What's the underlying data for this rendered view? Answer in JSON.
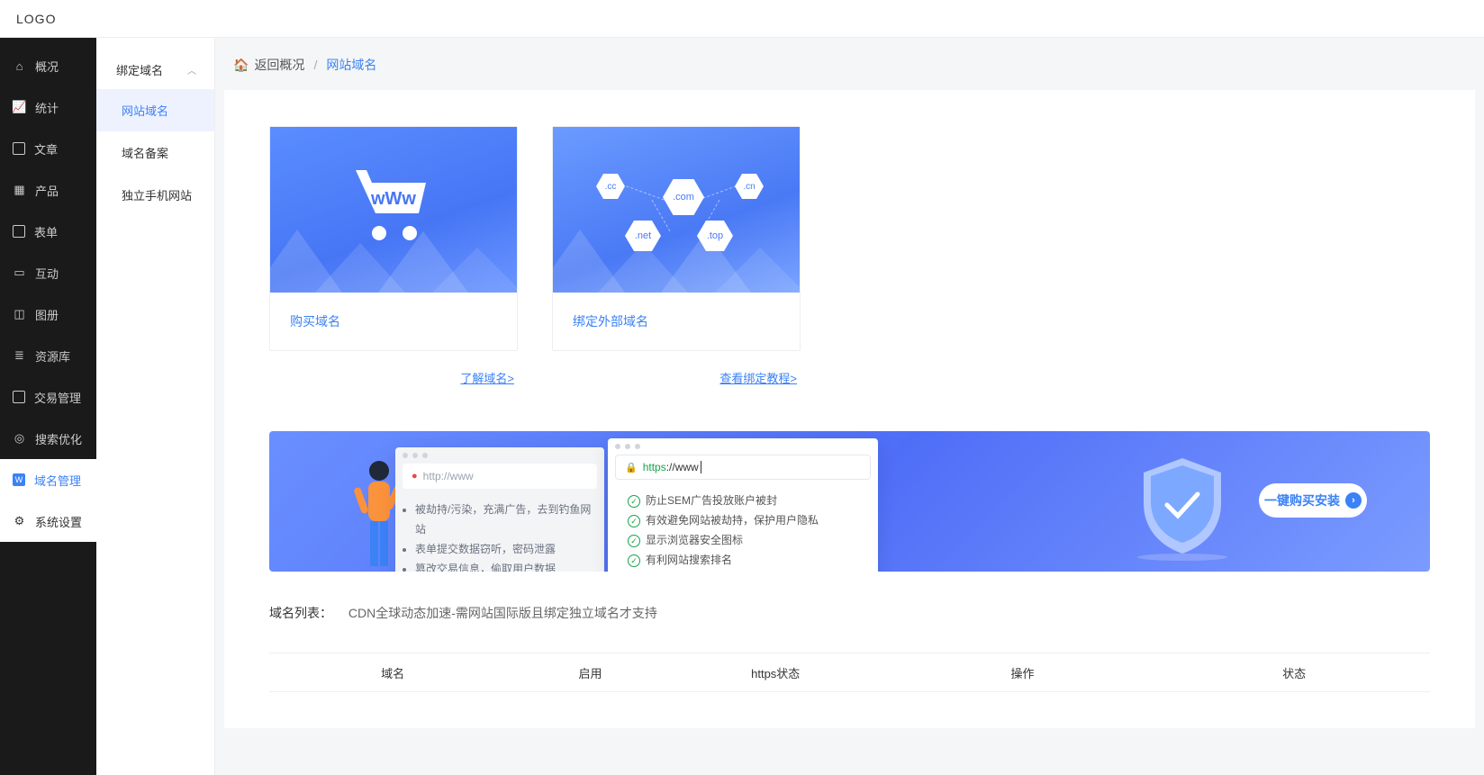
{
  "header": {
    "logo": "LOGO"
  },
  "sidebar": [
    {
      "icon": "home",
      "label": "概况"
    },
    {
      "icon": "chart",
      "label": "统计"
    },
    {
      "icon": "doc",
      "label": "文章"
    },
    {
      "icon": "grid",
      "label": "产品"
    },
    {
      "icon": "form",
      "label": "表单"
    },
    {
      "icon": "chat",
      "label": "互动"
    },
    {
      "icon": "gallery",
      "label": "图册"
    },
    {
      "icon": "db",
      "label": "资源库"
    },
    {
      "icon": "trade",
      "label": "交易管理"
    },
    {
      "icon": "search",
      "label": "搜索优化"
    },
    {
      "icon": "w",
      "label": "域名管理",
      "activeBlue": true
    },
    {
      "icon": "gear",
      "label": "系统设置",
      "whiteBg": true
    }
  ],
  "subnav": {
    "title": "绑定域名",
    "items": [
      {
        "label": "网站域名",
        "active": true
      },
      {
        "label": "域名备案"
      },
      {
        "label": "独立手机网站"
      }
    ]
  },
  "breadcrumb": {
    "back": "返回概况",
    "sep": "/",
    "current": "网站域名"
  },
  "cards": [
    {
      "label": "购买域名",
      "link": "了解域名>"
    },
    {
      "label": "绑定外部域名",
      "link": "查看绑定教程>"
    }
  ],
  "tlds": {
    "cc": ".cc",
    "com": ".com",
    "cn": ".cn",
    "net": ".net",
    "top": ".top"
  },
  "banner": {
    "http": "http://www",
    "https_prefix": "https",
    "https_rest": "://www",
    "left": [
      "被劫持/污染，充满广告，去到钓鱼网站",
      "表单提交数据窃听，密码泄露",
      "篡改交易信息，偷取用户数据"
    ],
    "right": [
      "防止SEM广告投放账户被封",
      "有效避免网站被劫持，保护用户隐私",
      "显示浏览器安全图标",
      "有利网站搜索排名"
    ],
    "button": "一键购买安装"
  },
  "list": {
    "title": "域名列表：",
    "sub": "CDN全球动态加速-需网站国际版且绑定独立域名才支持"
  },
  "table": {
    "headers": [
      "域名",
      "启用",
      "https状态",
      "操作",
      "状态"
    ]
  }
}
